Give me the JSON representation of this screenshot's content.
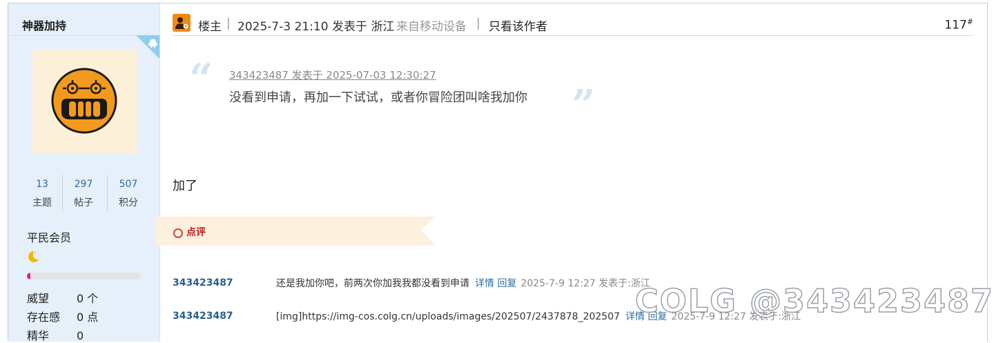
{
  "sidebar": {
    "username": "神器加持",
    "stats": [
      {
        "value": "13",
        "label": "主题"
      },
      {
        "value": "297",
        "label": "帖子"
      },
      {
        "value": "507",
        "label": "积分"
      }
    ],
    "member_level": "平民会员",
    "level_progress": 0.03,
    "attributes": [
      {
        "key": "威望",
        "value": "0 个"
      },
      {
        "key": "存在感",
        "value": "0 点"
      },
      {
        "key": "精华",
        "value": "0"
      }
    ]
  },
  "post": {
    "role": "楼主",
    "date_published": "2025-7-3 21:10 发表于 浙江",
    "source": "来自移动设备",
    "only_author": "只看该作者",
    "floor": "117",
    "floor_mark": "#",
    "quote": {
      "meta": "343423487 发表于 2025-07-03 12:30:27",
      "text": "没看到申请，再加一下试试，或者你冒险团叫啥我加你"
    },
    "body": "加了"
  },
  "comments_section": {
    "label": "点评",
    "items": [
      {
        "user": "343423487",
        "text": "还是我加你吧，前两次你加我我都没看到申请",
        "detail_link": "详情",
        "reply_link": "回复",
        "time": "2025-7-9 12:27 发表于:浙江"
      },
      {
        "user": "343423487",
        "text": "[img]https://img-cos.colg.cn/uploads/images/202507/2437878_202507",
        "detail_link": "详情",
        "reply_link": "回复",
        "time": "2025-7-9 12:27 发表于:浙江"
      }
    ]
  },
  "watermark": "COLG @343423487",
  "colors": {
    "sidebar_bg": "#e6f0fa",
    "accent_orange": "#f08a16",
    "comment_red": "#c01a1a",
    "link_blue": "#2a6ea3"
  }
}
